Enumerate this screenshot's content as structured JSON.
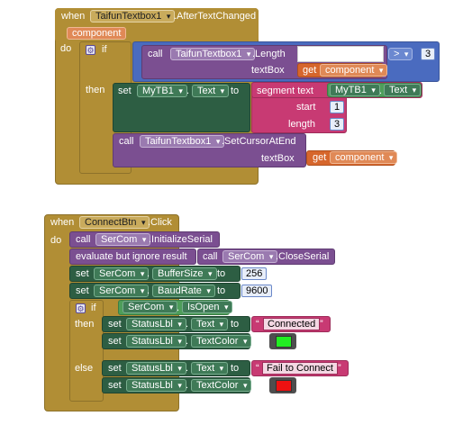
{
  "block1": {
    "when": "when",
    "component_select": "TaifunTextbox1",
    "event": ".AfterTextChanged",
    "param": "component",
    "do": "do",
    "if": "if",
    "then": "then",
    "call1": "call",
    "call1_component": "TaifunTextbox1",
    "call1_method": ".Length",
    "textbox_label": "textBox",
    "get1": "get",
    "get1_value": "component",
    "compare_op": ">",
    "compare_value": "3",
    "set1": "set",
    "set1_component": "MyTB1",
    "dot1": ".",
    "set1_property": "Text",
    "to1": "to",
    "segment": "segment  text",
    "seg_component": "MyTB1",
    "dot2": ".",
    "seg_property": "Text",
    "start_label": "start",
    "start_value": "1",
    "length_label": "length",
    "length_value": "3",
    "call2": "call",
    "call2_component": "TaifunTextbox1",
    "call2_method": ".SetCursorAtEnd",
    "textbox2_label": "textBox",
    "get2": "get",
    "get2_value": "component"
  },
  "block2": {
    "when": "when",
    "component_select": "ConnectBtn",
    "event": ".Click",
    "do": "do",
    "call1": "call",
    "call1_component": "SerCom",
    "call1_method": ".InitializeSerial",
    "evaluate": "evaluate but ignore result",
    "call2": "call",
    "call2_component": "SerCom",
    "call2_method": ".CloseSerial",
    "set1": "set",
    "set1_component": "SerCom",
    "set1_property": "BufferSize",
    "to1": "to",
    "set1_value": "256",
    "set2": "set",
    "set2_component": "SerCom",
    "set2_property": "BaudRate",
    "to2": "to",
    "set2_value": "9600",
    "dot": ".",
    "if": "if",
    "if_component": "SerCom",
    "if_property": "IsOpen",
    "then": "then",
    "else": "else",
    "then_set1": "set",
    "then_set1_component": "StatusLbl",
    "then_set1_property": "Text",
    "then_to1": "to",
    "then_string": "Connected",
    "then_set2": "set",
    "then_set2_component": "StatusLbl",
    "then_set2_property": "TextColor",
    "then_to2": "to",
    "then_color": "#22ee22",
    "else_set1": "set",
    "else_set1_component": "StatusLbl",
    "else_set1_property": "Text",
    "else_to1": "to",
    "else_string": "Fail to Connect",
    "else_set2": "set",
    "else_set2_component": "StatusLbl",
    "else_set2_property": "TextColor",
    "else_to2": "to",
    "else_color": "#ee1111",
    "quote_open": "“",
    "quote_close": "”"
  },
  "colors": {
    "event": "#b18e35",
    "component": "#7b4f91",
    "setter": "#2d5e43",
    "text": "#c83a73",
    "math": "#4a6bbf",
    "variable": "#d6662c"
  }
}
